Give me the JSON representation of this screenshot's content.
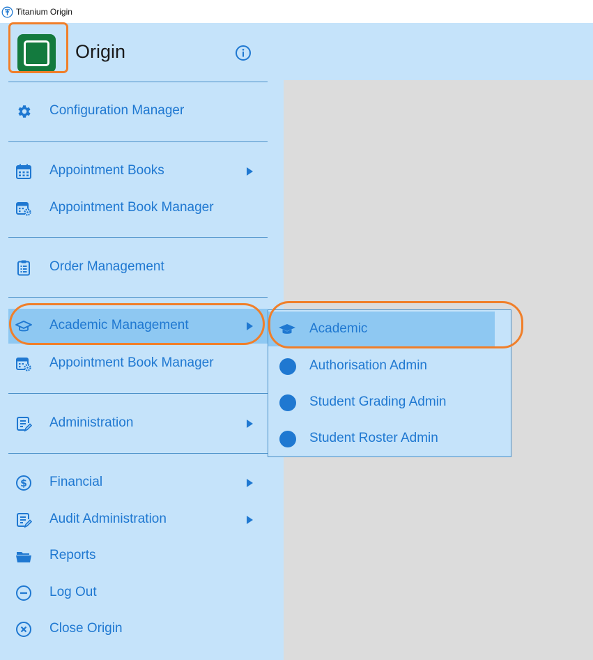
{
  "window": {
    "title": "Titanium Origin"
  },
  "header": {
    "app_name": "Origin"
  },
  "menu": {
    "config": "Configuration Manager",
    "appt_books": "Appointment Books",
    "appt_book_manager": "Appointment Book Manager",
    "order_mgmt": "Order Management",
    "academic_mgmt": "Academic Management",
    "appt_book_manager_2": "Appointment Book Manager",
    "administration": "Administration",
    "financial": "Financial",
    "audit_admin": "Audit Administration",
    "reports": "Reports",
    "log_out": "Log Out",
    "close_origin": "Close Origin"
  },
  "submenu": {
    "academic": "Academic",
    "authorisation_admin": "Authorisation Admin",
    "student_grading_admin": "Student Grading Admin",
    "student_roster_admin": "Student Roster Admin"
  },
  "colors": {
    "accent": "#1f78d1",
    "sidebar_bg": "#c5e3fa",
    "active_bg": "#8ec8f2",
    "highlight": "#f07f2a",
    "logo": "#137a3e",
    "content_bg": "#dcdcdc"
  },
  "icons": {
    "config": "gear-icon",
    "appt_books": "calendar-icon",
    "appt_book_manager": "calendar-gear-icon",
    "order_mgmt": "clipboard-icon",
    "academic_mgmt": "graduation-cap-icon",
    "administration": "document-edit-icon",
    "financial": "dollar-circle-icon",
    "audit_admin": "document-edit-icon",
    "reports": "folder-open-icon",
    "log_out": "minus-circle-icon",
    "close_origin": "close-circle-icon",
    "info": "info-icon"
  }
}
